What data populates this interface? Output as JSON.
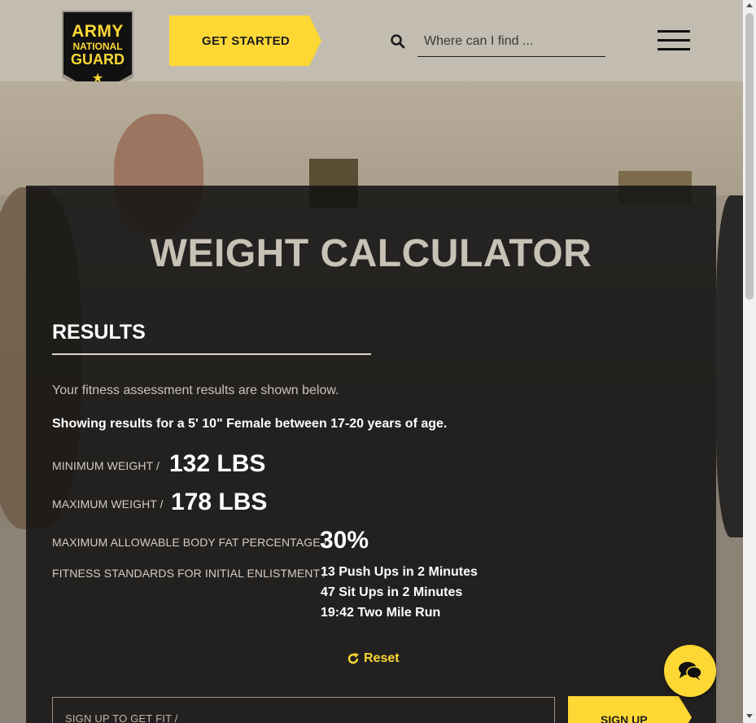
{
  "header": {
    "logo": {
      "line1": "ARMY",
      "line2": "NATIONAL",
      "line3": "GUARD",
      "star": "★"
    },
    "get_started_label": "GET STARTED",
    "search": {
      "placeholder": "Where can I find ...",
      "value": "",
      "icon": "search-icon"
    },
    "menu_icon": "hamburger-menu-icon"
  },
  "main": {
    "title": "WEIGHT CALCULATOR",
    "results_heading": "RESULTS",
    "intro": "Your fitness assessment results are shown below.",
    "showing": "Showing results for a 5' 10\" Female between 17-20 years of age.",
    "min_weight": {
      "label": "MINIMUM WEIGHT /",
      "value": "132 LBS"
    },
    "max_weight": {
      "label": "MAXIMUM WEIGHT /",
      "value": "178 LBS"
    },
    "body_fat": {
      "label": "MAXIMUM ALLOWABLE BODY FAT PERCENTAGE /",
      "value": "30%"
    },
    "fitness": {
      "label": "FITNESS STANDARDS FOR INITIAL ENLISTMENT /",
      "items": [
        "13 Push Ups in 2 Minutes",
        "47 Sit Ups in 2 Minutes",
        "19:42 Two Mile Run"
      ]
    },
    "reset_label": "Reset",
    "signup_field_label": "SIGN UP TO GET FIT /",
    "signup_button_label": "SIGN UP"
  },
  "chat_icon": "chat-bubbles-icon",
  "colors": {
    "accent": "#fdd835",
    "header_bg": "#c3bcb1",
    "panel_bg": "#121212"
  }
}
